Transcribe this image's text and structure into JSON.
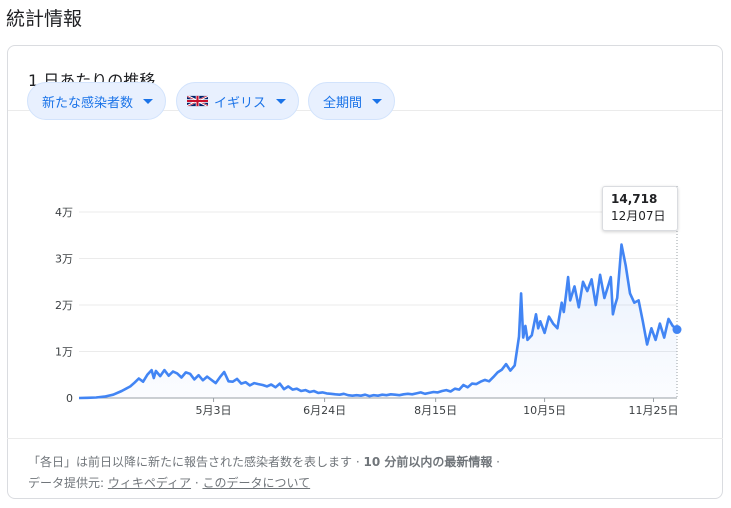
{
  "page_title": "統計情報",
  "card_title": "1 日あたりの推移",
  "filters": {
    "metric": "新たな感染者数",
    "region": "イギリス",
    "period": "全期間"
  },
  "tooltip": {
    "value": "14,718",
    "date": "12月07日"
  },
  "footer": {
    "note_prefix": "「各日」は前日以降に新たに報告された感染者数を表します",
    "sep1": " · ",
    "note_bold": "10 分前以内の最新情報",
    "sep2": " ·",
    "source_label": "データ提供元: ",
    "source_link": "ウィキペディア",
    "sep3": " · ",
    "about_link": "このデータについて"
  },
  "chart_data": {
    "type": "area",
    "y_ticks": [
      "0",
      "1万",
      "2万",
      "3万",
      "4万"
    ],
    "y_tick_values": [
      0,
      10000,
      20000,
      30000,
      40000
    ],
    "ylim": [
      0,
      40000
    ],
    "x_ticks": [
      "5月3日",
      "6月24日",
      "8月15日",
      "10月5日",
      "11月25日"
    ],
    "x_tick_days": [
      63,
      115,
      167,
      218,
      269
    ],
    "x_range_days": [
      0,
      280
    ],
    "series": [
      {
        "color": "#4285f4",
        "points": [
          [
            0,
            0
          ],
          [
            4,
            50
          ],
          [
            8,
            100
          ],
          [
            12,
            300
          ],
          [
            16,
            700
          ],
          [
            20,
            1500
          ],
          [
            24,
            2500
          ],
          [
            26,
            3300
          ],
          [
            28,
            4200
          ],
          [
            30,
            3500
          ],
          [
            32,
            5000
          ],
          [
            34,
            6000
          ],
          [
            35,
            4300
          ],
          [
            36,
            5800
          ],
          [
            38,
            4700
          ],
          [
            40,
            6000
          ],
          [
            42,
            4800
          ],
          [
            44,
            5700
          ],
          [
            46,
            5300
          ],
          [
            48,
            4400
          ],
          [
            50,
            5500
          ],
          [
            52,
            5200
          ],
          [
            54,
            4000
          ],
          [
            56,
            4900
          ],
          [
            58,
            3800
          ],
          [
            60,
            4600
          ],
          [
            62,
            3900
          ],
          [
            64,
            3200
          ],
          [
            66,
            4500
          ],
          [
            68,
            5600
          ],
          [
            70,
            3600
          ],
          [
            72,
            3500
          ],
          [
            74,
            4100
          ],
          [
            76,
            3100
          ],
          [
            78,
            3400
          ],
          [
            80,
            2700
          ],
          [
            82,
            3200
          ],
          [
            84,
            3000
          ],
          [
            86,
            2800
          ],
          [
            88,
            2500
          ],
          [
            90,
            2900
          ],
          [
            92,
            2300
          ],
          [
            94,
            3100
          ],
          [
            96,
            1900
          ],
          [
            98,
            2500
          ],
          [
            100,
            1800
          ],
          [
            102,
            2000
          ],
          [
            104,
            1500
          ],
          [
            106,
            1700
          ],
          [
            108,
            1300
          ],
          [
            110,
            1500
          ],
          [
            112,
            1100
          ],
          [
            114,
            1200
          ],
          [
            116,
            1000
          ],
          [
            118,
            900
          ],
          [
            120,
            800
          ],
          [
            122,
            700
          ],
          [
            124,
            900
          ],
          [
            126,
            600
          ],
          [
            128,
            500
          ],
          [
            130,
            600
          ],
          [
            132,
            500
          ],
          [
            134,
            700
          ],
          [
            136,
            400
          ],
          [
            138,
            600
          ],
          [
            140,
            500
          ],
          [
            142,
            700
          ],
          [
            144,
            600
          ],
          [
            146,
            800
          ],
          [
            148,
            700
          ],
          [
            150,
            600
          ],
          [
            152,
            800
          ],
          [
            154,
            900
          ],
          [
            156,
            800
          ],
          [
            158,
            1000
          ],
          [
            160,
            1200
          ],
          [
            162,
            900
          ],
          [
            164,
            1100
          ],
          [
            166,
            1300
          ],
          [
            168,
            1200
          ],
          [
            170,
            1500
          ],
          [
            172,
            1700
          ],
          [
            174,
            1400
          ],
          [
            176,
            2000
          ],
          [
            178,
            1800
          ],
          [
            180,
            2800
          ],
          [
            182,
            2300
          ],
          [
            184,
            3100
          ],
          [
            186,
            3000
          ],
          [
            188,
            3500
          ],
          [
            190,
            3900
          ],
          [
            192,
            3600
          ],
          [
            194,
            4500
          ],
          [
            196,
            5500
          ],
          [
            198,
            6100
          ],
          [
            200,
            7300
          ],
          [
            202,
            5900
          ],
          [
            204,
            7000
          ],
          [
            206,
            13200
          ],
          [
            207,
            22500
          ],
          [
            208,
            13000
          ],
          [
            209,
            15500
          ],
          [
            210,
            12500
          ],
          [
            212,
            13500
          ],
          [
            214,
            18000
          ],
          [
            215,
            15000
          ],
          [
            216,
            16500
          ],
          [
            218,
            14000
          ],
          [
            220,
            17500
          ],
          [
            222,
            16000
          ],
          [
            224,
            15000
          ],
          [
            226,
            20500
          ],
          [
            227,
            18500
          ],
          [
            228,
            22000
          ],
          [
            229,
            26000
          ],
          [
            230,
            21000
          ],
          [
            232,
            24000
          ],
          [
            234,
            19500
          ],
          [
            236,
            25000
          ],
          [
            238,
            23000
          ],
          [
            240,
            25500
          ],
          [
            242,
            20000
          ],
          [
            244,
            26500
          ],
          [
            246,
            21500
          ],
          [
            248,
            24500
          ],
          [
            249,
            26000
          ],
          [
            250,
            18000
          ],
          [
            251,
            20000
          ],
          [
            252,
            21500
          ],
          [
            254,
            33000
          ],
          [
            256,
            28500
          ],
          [
            258,
            22500
          ],
          [
            260,
            20500
          ],
          [
            262,
            21000
          ],
          [
            264,
            16500
          ],
          [
            266,
            11500
          ],
          [
            268,
            15000
          ],
          [
            270,
            12500
          ],
          [
            272,
            16000
          ],
          [
            274,
            13000
          ],
          [
            276,
            17000
          ],
          [
            278,
            15500
          ],
          [
            280,
            14718
          ]
        ]
      }
    ],
    "highlight_point": {
      "day": 280,
      "value": 14718
    }
  }
}
